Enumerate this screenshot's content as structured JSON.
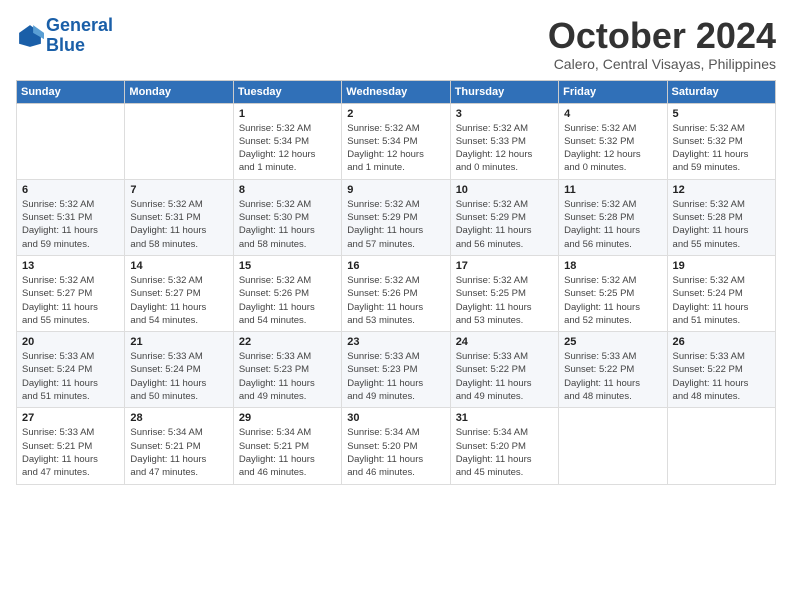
{
  "logo": {
    "text_general": "General",
    "text_blue": "Blue"
  },
  "header": {
    "month_year": "October 2024",
    "location": "Calero, Central Visayas, Philippines"
  },
  "days_of_week": [
    "Sunday",
    "Monday",
    "Tuesday",
    "Wednesday",
    "Thursday",
    "Friday",
    "Saturday"
  ],
  "weeks": [
    [
      {
        "num": "",
        "info": ""
      },
      {
        "num": "",
        "info": ""
      },
      {
        "num": "1",
        "info": "Sunrise: 5:32 AM\nSunset: 5:34 PM\nDaylight: 12 hours\nand 1 minute."
      },
      {
        "num": "2",
        "info": "Sunrise: 5:32 AM\nSunset: 5:34 PM\nDaylight: 12 hours\nand 1 minute."
      },
      {
        "num": "3",
        "info": "Sunrise: 5:32 AM\nSunset: 5:33 PM\nDaylight: 12 hours\nand 0 minutes."
      },
      {
        "num": "4",
        "info": "Sunrise: 5:32 AM\nSunset: 5:32 PM\nDaylight: 12 hours\nand 0 minutes."
      },
      {
        "num": "5",
        "info": "Sunrise: 5:32 AM\nSunset: 5:32 PM\nDaylight: 11 hours\nand 59 minutes."
      }
    ],
    [
      {
        "num": "6",
        "info": "Sunrise: 5:32 AM\nSunset: 5:31 PM\nDaylight: 11 hours\nand 59 minutes."
      },
      {
        "num": "7",
        "info": "Sunrise: 5:32 AM\nSunset: 5:31 PM\nDaylight: 11 hours\nand 58 minutes."
      },
      {
        "num": "8",
        "info": "Sunrise: 5:32 AM\nSunset: 5:30 PM\nDaylight: 11 hours\nand 58 minutes."
      },
      {
        "num": "9",
        "info": "Sunrise: 5:32 AM\nSunset: 5:29 PM\nDaylight: 11 hours\nand 57 minutes."
      },
      {
        "num": "10",
        "info": "Sunrise: 5:32 AM\nSunset: 5:29 PM\nDaylight: 11 hours\nand 56 minutes."
      },
      {
        "num": "11",
        "info": "Sunrise: 5:32 AM\nSunset: 5:28 PM\nDaylight: 11 hours\nand 56 minutes."
      },
      {
        "num": "12",
        "info": "Sunrise: 5:32 AM\nSunset: 5:28 PM\nDaylight: 11 hours\nand 55 minutes."
      }
    ],
    [
      {
        "num": "13",
        "info": "Sunrise: 5:32 AM\nSunset: 5:27 PM\nDaylight: 11 hours\nand 55 minutes."
      },
      {
        "num": "14",
        "info": "Sunrise: 5:32 AM\nSunset: 5:27 PM\nDaylight: 11 hours\nand 54 minutes."
      },
      {
        "num": "15",
        "info": "Sunrise: 5:32 AM\nSunset: 5:26 PM\nDaylight: 11 hours\nand 54 minutes."
      },
      {
        "num": "16",
        "info": "Sunrise: 5:32 AM\nSunset: 5:26 PM\nDaylight: 11 hours\nand 53 minutes."
      },
      {
        "num": "17",
        "info": "Sunrise: 5:32 AM\nSunset: 5:25 PM\nDaylight: 11 hours\nand 53 minutes."
      },
      {
        "num": "18",
        "info": "Sunrise: 5:32 AM\nSunset: 5:25 PM\nDaylight: 11 hours\nand 52 minutes."
      },
      {
        "num": "19",
        "info": "Sunrise: 5:32 AM\nSunset: 5:24 PM\nDaylight: 11 hours\nand 51 minutes."
      }
    ],
    [
      {
        "num": "20",
        "info": "Sunrise: 5:33 AM\nSunset: 5:24 PM\nDaylight: 11 hours\nand 51 minutes."
      },
      {
        "num": "21",
        "info": "Sunrise: 5:33 AM\nSunset: 5:24 PM\nDaylight: 11 hours\nand 50 minutes."
      },
      {
        "num": "22",
        "info": "Sunrise: 5:33 AM\nSunset: 5:23 PM\nDaylight: 11 hours\nand 49 minutes."
      },
      {
        "num": "23",
        "info": "Sunrise: 5:33 AM\nSunset: 5:23 PM\nDaylight: 11 hours\nand 49 minutes."
      },
      {
        "num": "24",
        "info": "Sunrise: 5:33 AM\nSunset: 5:22 PM\nDaylight: 11 hours\nand 49 minutes."
      },
      {
        "num": "25",
        "info": "Sunrise: 5:33 AM\nSunset: 5:22 PM\nDaylight: 11 hours\nand 48 minutes."
      },
      {
        "num": "26",
        "info": "Sunrise: 5:33 AM\nSunset: 5:22 PM\nDaylight: 11 hours\nand 48 minutes."
      }
    ],
    [
      {
        "num": "27",
        "info": "Sunrise: 5:33 AM\nSunset: 5:21 PM\nDaylight: 11 hours\nand 47 minutes."
      },
      {
        "num": "28",
        "info": "Sunrise: 5:34 AM\nSunset: 5:21 PM\nDaylight: 11 hours\nand 47 minutes."
      },
      {
        "num": "29",
        "info": "Sunrise: 5:34 AM\nSunset: 5:21 PM\nDaylight: 11 hours\nand 46 minutes."
      },
      {
        "num": "30",
        "info": "Sunrise: 5:34 AM\nSunset: 5:20 PM\nDaylight: 11 hours\nand 46 minutes."
      },
      {
        "num": "31",
        "info": "Sunrise: 5:34 AM\nSunset: 5:20 PM\nDaylight: 11 hours\nand 45 minutes."
      },
      {
        "num": "",
        "info": ""
      },
      {
        "num": "",
        "info": ""
      }
    ]
  ]
}
